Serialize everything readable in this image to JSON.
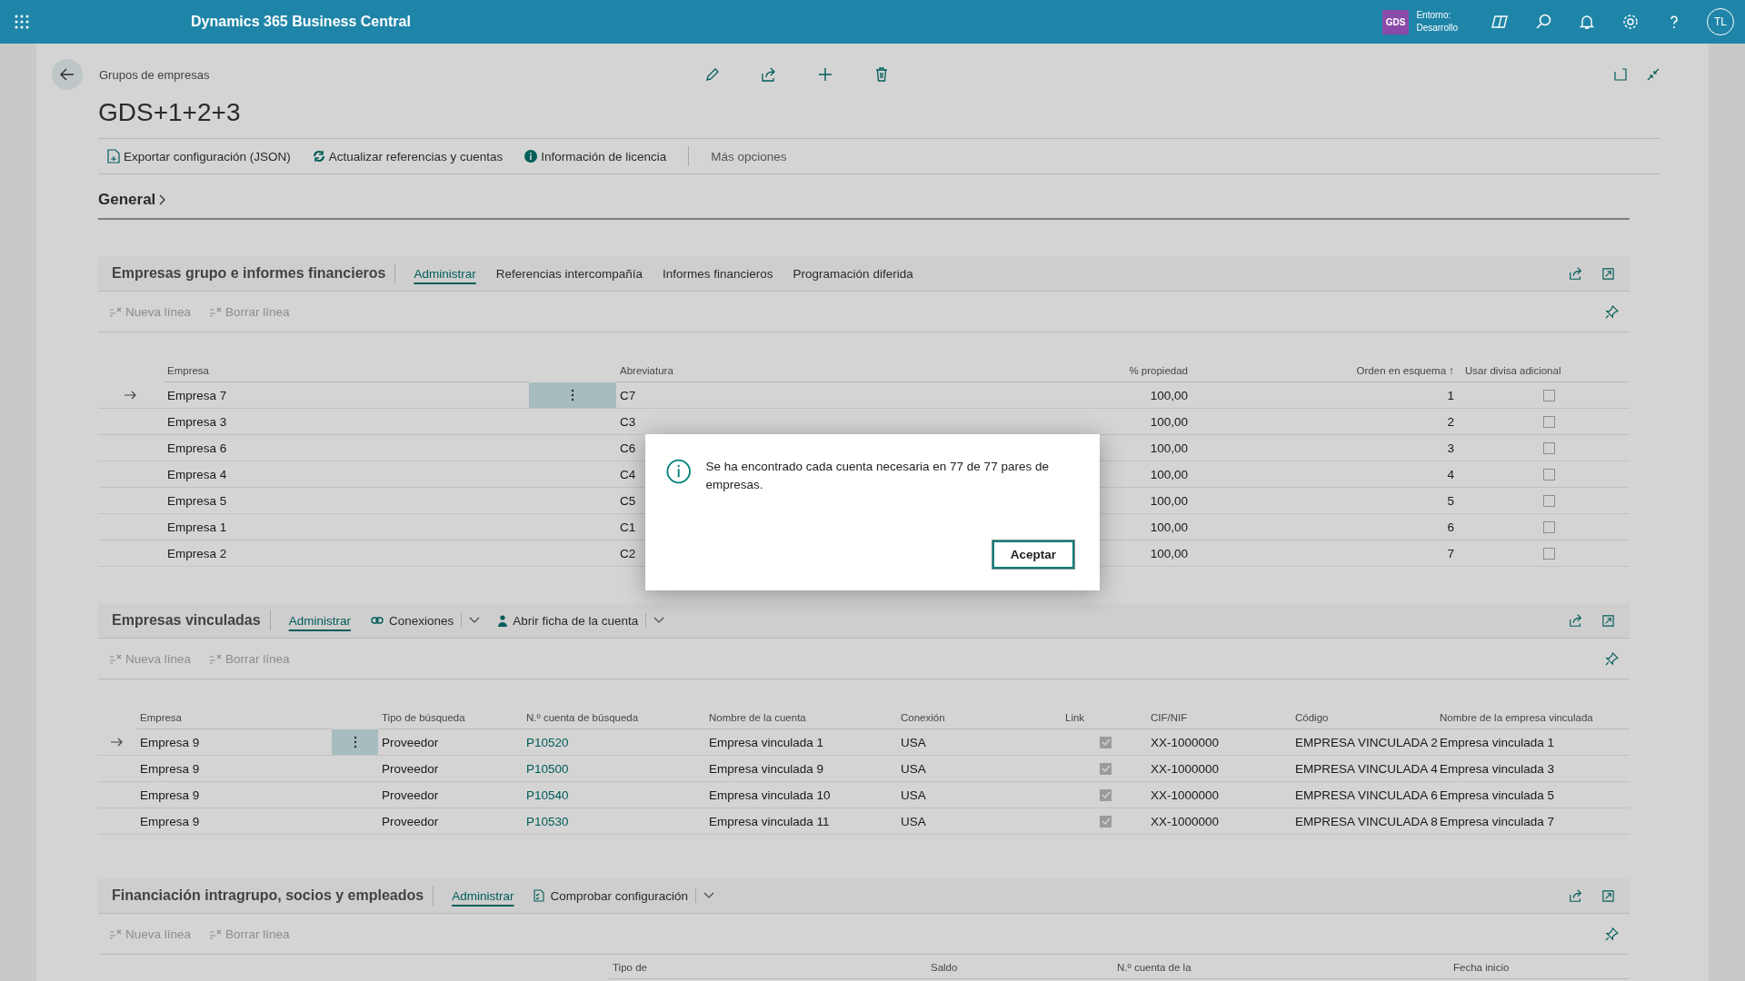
{
  "app_bar": {
    "title": "Dynamics 365 Business Central",
    "company_badge": "GDS",
    "environment_label": "Entorno:",
    "environment": "Desarrollo",
    "avatar": "TL"
  },
  "page": {
    "breadcrumb": "Grupos de empresas",
    "title": "GDS+1+2+3",
    "actions": [
      {
        "label": "Exportar configuración (JSON)",
        "kind": "action"
      },
      {
        "label": "Actualizar referencias y cuentas",
        "kind": "action"
      },
      {
        "label": "Información de licencia",
        "kind": "action"
      },
      {
        "label": "Más opciones",
        "kind": "more"
      }
    ],
    "general": "General"
  },
  "sections": [
    {
      "title": "Empresas grupo e informes financieros",
      "actions": [
        {
          "label": "Administrar",
          "kind": "tab",
          "selected": true
        },
        {
          "label": "Referencias intercompañía",
          "kind": "tab",
          "selected": false
        },
        {
          "label": "Informes financieros",
          "kind": "tab",
          "selected": false
        },
        {
          "label": "Programación diferida",
          "kind": "tab",
          "selected": false
        }
      ],
      "toolbar": [
        {
          "label": "Nueva línea",
          "disabled": true
        },
        {
          "label": "Borrar línea",
          "disabled": true
        }
      ],
      "table": {
        "columns": [
          "Empresa",
          "Abreviatura",
          "% propiedad",
          "Orden en esquema ↑",
          "Usar divisa adicional"
        ],
        "rows": [
          {
            "selected": true,
            "cells": [
              "Empresa 7",
              "C7",
              "100,00",
              "1"
            ],
            "checked": false
          },
          {
            "selected": false,
            "cells": [
              "Empresa 3",
              "C3",
              "100,00",
              "2"
            ],
            "checked": false
          },
          {
            "selected": false,
            "cells": [
              "Empresa 6",
              "C6",
              "100,00",
              "3"
            ],
            "checked": false
          },
          {
            "selected": false,
            "cells": [
              "Empresa 4",
              "C4",
              "100,00",
              "4"
            ],
            "checked": false
          },
          {
            "selected": false,
            "cells": [
              "Empresa 5",
              "C5",
              "100,00",
              "5"
            ],
            "checked": false
          },
          {
            "selected": false,
            "cells": [
              "Empresa 1",
              "C1",
              "100,00",
              "6"
            ],
            "checked": false
          },
          {
            "selected": false,
            "cells": [
              "Empresa 2",
              "C2",
              "100,00",
              "7"
            ],
            "checked": false
          }
        ]
      }
    },
    {
      "title": "Empresas vinculadas",
      "actions": [
        {
          "label": "Administrar",
          "kind": "tab",
          "selected": true
        },
        {
          "label": "Conexiones",
          "kind": "menu",
          "selected": false
        },
        {
          "label": "Abrir ficha de la cuenta",
          "kind": "menu",
          "selected": false
        }
      ],
      "toolbar": [
        {
          "label": "Nueva línea",
          "disabled": true
        },
        {
          "label": "Borrar línea",
          "disabled": true
        }
      ],
      "table": {
        "columns": [
          "Empresa",
          "Tipo de búsqueda",
          "N.º cuenta de búsqueda",
          "Nombre de la cuenta",
          "Conexión",
          "Link",
          "CIF/NIF",
          "Código",
          "Nombre de la empresa vinculada"
        ],
        "rows": [
          {
            "selected": true,
            "cells": [
              "Empresa 9",
              "Proveedor",
              "P10520",
              "Empresa vinculada 1",
              "USA",
              "",
              "XX-1000000",
              "EMPRESA VINCULADA 2",
              "Empresa vinculada 1"
            ],
            "checked": true
          },
          {
            "selected": false,
            "cells": [
              "Empresa 9",
              "Proveedor",
              "P10500",
              "Empresa vinculada 9",
              "USA",
              "",
              "XX-1000000",
              "EMPRESA VINCULADA 4",
              "Empresa vinculada 3"
            ],
            "checked": true
          },
          {
            "selected": false,
            "cells": [
              "Empresa 9",
              "Proveedor",
              "P10540",
              "Empresa vinculada 10",
              "USA",
              "",
              "XX-1000000",
              "EMPRESA VINCULADA 6",
              "Empresa vinculada 5"
            ],
            "checked": true
          },
          {
            "selected": false,
            "cells": [
              "Empresa 9",
              "Proveedor",
              "P10530",
              "Empresa vinculada 11",
              "USA",
              "",
              "XX-1000000",
              "EMPRESA VINCULADA 8",
              "Empresa vinculada 7"
            ],
            "checked": true
          }
        ]
      }
    },
    {
      "title": "Financiación intragrupo, socios y empleados",
      "actions": [
        {
          "label": "Administrar",
          "kind": "tab",
          "selected": true
        },
        {
          "label": "Comprobar configuración",
          "kind": "menu",
          "selected": false
        }
      ],
      "toolbar": [
        {
          "label": "Nueva línea",
          "disabled": true
        },
        {
          "label": "Borrar línea",
          "disabled": true
        }
      ],
      "table": {
        "columns": [
          "Tipo de",
          "Saldo",
          "N.º cuenta de la",
          "Fecha inicio"
        ]
      }
    }
  ],
  "dialog": {
    "message": "Se ha encontrado cada cuenta necesaria en 77 de 77 pares de empresas.",
    "button": "Aceptar"
  }
}
